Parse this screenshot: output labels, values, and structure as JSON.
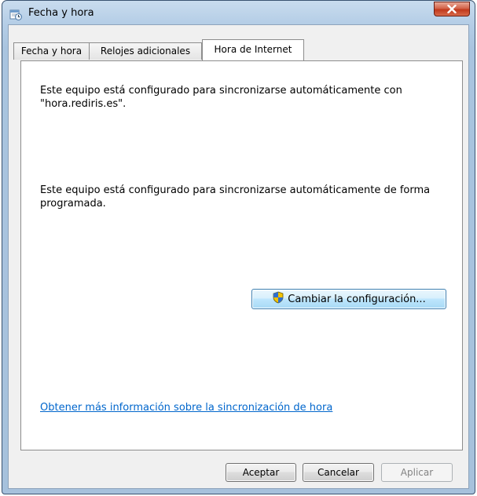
{
  "window": {
    "title": "Fecha y hora",
    "icon": "clock-calendar-icon",
    "close_icon": "close-icon"
  },
  "tabs": [
    {
      "label": "Fecha y hora",
      "active": false
    },
    {
      "label": "Relojes adicionales",
      "active": false
    },
    {
      "label": "Hora de Internet",
      "active": true
    }
  ],
  "panel": {
    "sync_server_text": "Este equipo está configurado para sincronizarse automáticamente con \"hora.rediris.es\".",
    "schedule_text": "Este equipo está configurado para sincronizarse automáticamente de forma programada.",
    "change_button": "Cambiar la configuración...",
    "change_button_icon": "uac-shield-icon",
    "info_link": "Obtener más información sobre la sincronización de hora"
  },
  "footer": {
    "ok": "Aceptar",
    "cancel": "Cancelar",
    "apply": "Aplicar",
    "apply_enabled": false
  },
  "colors": {
    "link": "#0066cc",
    "close_button": "#c1391c",
    "frame": "#a9c4df"
  }
}
